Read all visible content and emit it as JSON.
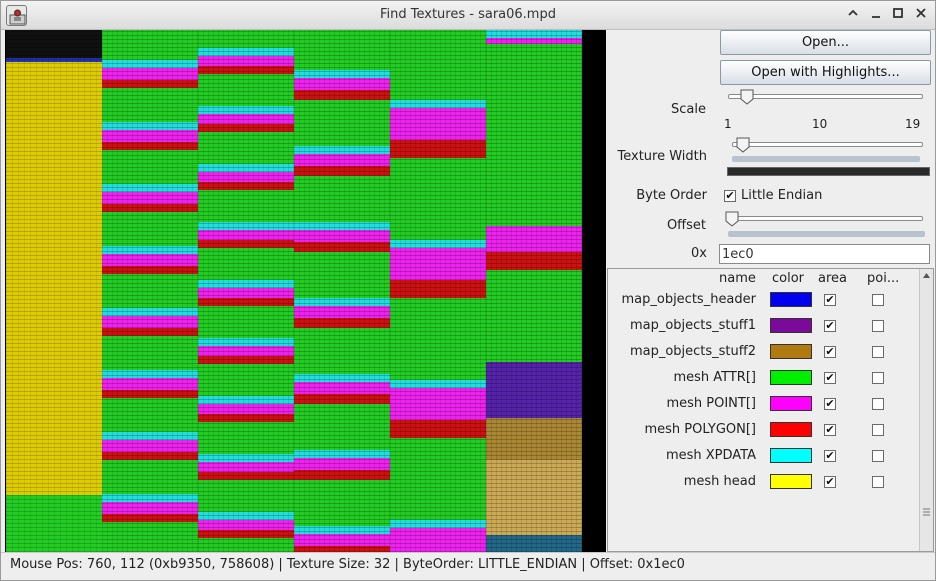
{
  "window": {
    "title": "Find Textures - sara06.mpd",
    "minimize_glyph": "–",
    "maximize_glyph": "□",
    "restore_glyph": "^",
    "close_glyph": "×"
  },
  "panel": {
    "open_label": "Open...",
    "open_highlights_label": "Open with Highlights...",
    "scale_label": "Scale",
    "scale_ticks": [
      "1",
      "10",
      "19"
    ],
    "scale_value": 2,
    "scale_min": 1,
    "scale_max": 19,
    "texture_width_label": "Texture Width",
    "byte_order_label": "Byte Order",
    "little_endian_label": "Little Endian",
    "little_endian_checked": true,
    "offset_label": "Offset",
    "hex_prefix_label": "0x",
    "hex_value": "1ec0"
  },
  "table": {
    "headers": {
      "name": "name",
      "color": "color",
      "area": "area",
      "points": "poi..."
    },
    "rows": [
      {
        "name": "map_objects_header",
        "color": "#0000ee",
        "area": true,
        "points": false
      },
      {
        "name": "map_objects_stuff1",
        "color": "#7b0a9a",
        "area": true,
        "points": false
      },
      {
        "name": "map_objects_stuff2",
        "color": "#b07a10",
        "area": true,
        "points": false
      },
      {
        "name": "mesh ATTR[]",
        "color": "#00ee00",
        "area": true,
        "points": false
      },
      {
        "name": "mesh POINT[]",
        "color": "#ff00ff",
        "area": true,
        "points": false
      },
      {
        "name": "mesh POLYGON[]",
        "color": "#ff0000",
        "area": true,
        "points": false
      },
      {
        "name": "mesh XPDATA",
        "color": "#00ffff",
        "area": true,
        "points": false
      },
      {
        "name": "mesh head",
        "color": "#ffff00",
        "area": true,
        "points": false
      }
    ]
  },
  "status": {
    "text": "Mouse Pos: 760, 112 (0xb9350, 758608) | Texture Size: 32 | ByteOrder: LITTLE_ENDIAN | Offset: 0x1ec0"
  },
  "colors": {
    "green": "#22cc22",
    "magenta": "#ee22ee",
    "red": "#cc1111",
    "cyan": "#22dddd",
    "yellow": "#ddcc00",
    "purple": "#5522aa",
    "brown": "#aa8833"
  }
}
